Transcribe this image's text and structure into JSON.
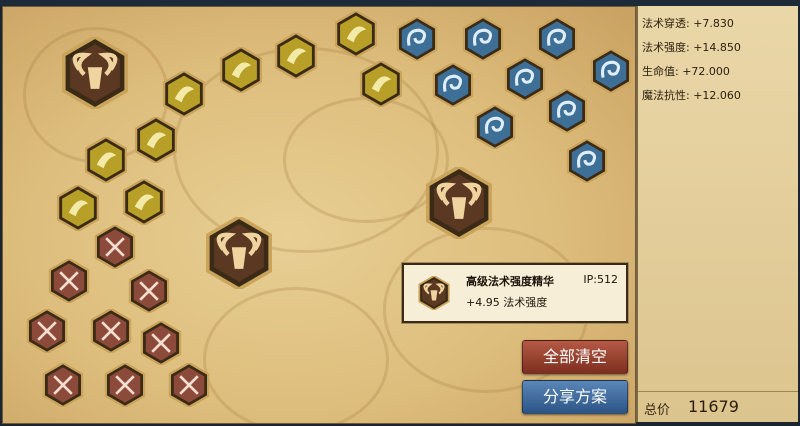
{
  "stats": [
    {
      "label": "法术穿透",
      "value": "+7.830"
    },
    {
      "label": "法术强度",
      "value": "+14.850"
    },
    {
      "label": "生命值",
      "value": "+72.000"
    },
    {
      "label": "魔法抗性",
      "value": "+12.060"
    }
  ],
  "total": {
    "label": "总价",
    "value": "11679"
  },
  "buttons": {
    "clear": "全部清空",
    "share": "分享方案"
  },
  "tooltip": {
    "name": "高级法术强度精华",
    "ip": "IP:512",
    "effect": "+4.95 法术强度"
  },
  "rune_types": {
    "quintessence": {
      "icon": "ram-head-icon",
      "color": "#5a3822"
    },
    "yellow": {
      "icon": "wing-icon",
      "color": "#b8a028"
    },
    "blue": {
      "icon": "spiral-horn-icon",
      "color": "#3e6f96"
    },
    "red": {
      "icon": "crossed-axes-icon",
      "color": "#8c4a3a"
    }
  },
  "placed_runes": {
    "quintessence": 3,
    "yellow": 9,
    "blue": 9,
    "red": 9
  }
}
